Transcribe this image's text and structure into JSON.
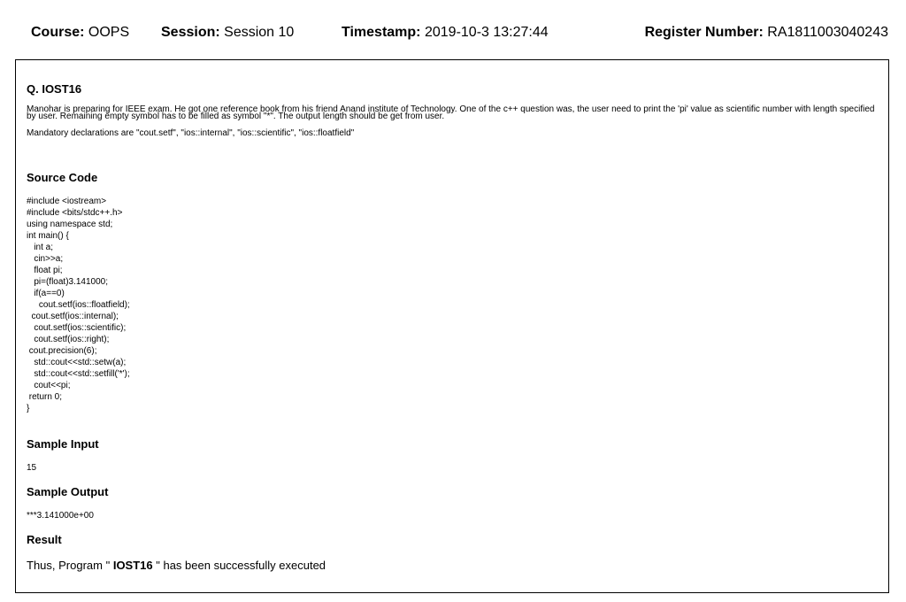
{
  "header": {
    "course_label": "Course:",
    "course_value": "OOPS",
    "session_label": "Session:",
    "session_value": "Session 10",
    "timestamp_label": "Timestamp:",
    "timestamp_value": "2019-10-3 13:27:44",
    "register_label": "Register Number:",
    "register_value": "RA1811003040243"
  },
  "question": {
    "title": "Q. IOST16",
    "text": "Manohar is preparing for IEEE exam. He got one reference book from his friend Anand institute of Technology. One of the c++ question was, the user need to print the 'pi' value as scientific number with length specified by user. Remaining empty symbol has to be filled as symbol \"*\". The output length should be get from user.",
    "declarations": "Mandatory declarations are \"cout.setf\", \"ios::internal\", \"ios::scientific\", \"ios::floatfield\""
  },
  "source": {
    "title": "Source Code",
    "code": "#include <iostream>\n#include <bits/stdc++.h>\nusing namespace std;\nint main() {\n   int a;\n   cin>>a;\n   float pi;\n   pi=(float)3.141000;\n   if(a==0)\n     cout.setf(ios::floatfield);\n  cout.setf(ios::internal);\n   cout.setf(ios::scientific);\n   cout.setf(ios::right);\n cout.precision(6);\n   std::cout<<std::setw(a);\n   std::cout<<std::setfill('*');\n   cout<<pi;\n return 0;\n}"
  },
  "sample_input": {
    "title": "Sample Input",
    "value": "15"
  },
  "sample_output": {
    "title": "Sample Output",
    "value": "***3.141000e+00"
  },
  "result": {
    "title": "Result",
    "prefix": "Thus, Program \"",
    "program": "IOST16",
    "suffix": "\" has been successfully executed"
  }
}
